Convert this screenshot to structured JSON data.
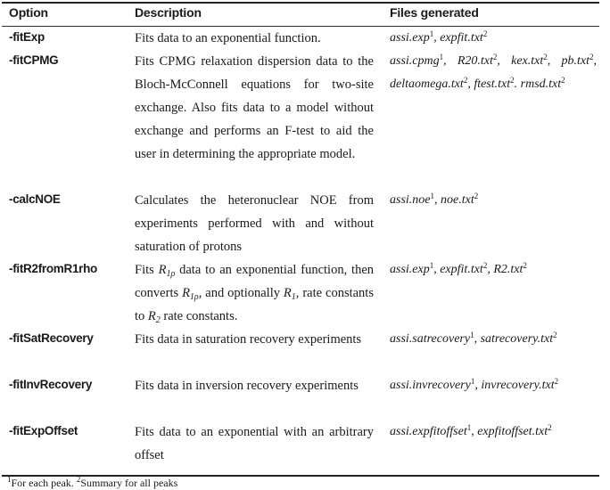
{
  "headers": {
    "option": "Option",
    "description": "Description",
    "files": "Files generated"
  },
  "rows": [
    {
      "option": "-fitExp",
      "description": "Fits data to an exponential function.",
      "files": [
        {
          "name": "assi.exp",
          "note": "1",
          "sep": ", "
        },
        {
          "name": "expfit.txt",
          "note": "2",
          "sep": ""
        }
      ]
    },
    {
      "option": "-fitCPMG",
      "description": "Fits CPMG relaxation dispersion data to the Bloch-McConnell equations for two-site exchange. Also fits data to a model without exchange and performs an F-test to aid the user in determining the appropriate model.",
      "files": [
        {
          "name": "assi.cpmg",
          "note": "1",
          "sep": ", "
        },
        {
          "name": "R20.txt",
          "note": "2",
          "sep": ", "
        },
        {
          "name": "kex.txt",
          "note": "2",
          "sep": ", "
        },
        {
          "name": "pb.txt",
          "note": "2",
          "sep": ", "
        },
        {
          "name": "deltaomega.txt",
          "note": "2",
          "sep": ", "
        },
        {
          "name": "ftest.txt",
          "note": "2",
          "sep": ". "
        },
        {
          "name": "rmsd.txt",
          "note": "2",
          "sep": ""
        }
      ]
    },
    {
      "option": "-calcNOE",
      "description": "Calculates the heteronuclear NOE from experiments performed with and without saturation of protons",
      "files": [
        {
          "name": "assi.noe",
          "note": "1",
          "sep": ", "
        },
        {
          "name": "noe.txt",
          "note": "2",
          "sep": ""
        }
      ]
    },
    {
      "option": "-fitR2fromR1rho",
      "description_parts": {
        "p1": "Fits ",
        "p2": " data to an exponential function, then converts ",
        "p3": ", and optionally ",
        "p4": ", rate constants to ",
        "p5": " rate constants.",
        "r1rho_base": "R",
        "r1rho_sub": "1ρ",
        "r1_base": "R",
        "r1_sub": "1",
        "r2_base": "R",
        "r2_sub": "2"
      },
      "files": [
        {
          "name": "assi.exp",
          "note": "1",
          "sep": ", "
        },
        {
          "name": "expfit.txt",
          "note": "2",
          "sep": ", "
        },
        {
          "name": "R2.txt",
          "note": "2",
          "sep": ""
        }
      ]
    },
    {
      "option": "-fitSatRecovery",
      "description": "Fits data in saturation recovery experiments",
      "files": [
        {
          "name": "assi.satrecovery",
          "note": "1",
          "sep": ", "
        },
        {
          "name": "satrecovery.txt",
          "note": "2",
          "sep": ""
        }
      ]
    },
    {
      "option": "-fitInvRecovery",
      "description": "Fits data in inversion recovery experiments",
      "files": [
        {
          "name": "assi.invrecovery",
          "note": "1",
          "sep": ", "
        },
        {
          "name": "invrecovery.txt",
          "note": "2",
          "sep": ""
        }
      ]
    },
    {
      "option": "-fitExpOffset",
      "description": "Fits data to an exponential with an arbitrary offset",
      "files": [
        {
          "name": "assi.expfitoffset",
          "note": "1",
          "sep": ", "
        },
        {
          "name": "expfitoffset.txt",
          "note": "2",
          "sep": ""
        }
      ]
    }
  ],
  "footnote": {
    "n1": "1",
    "t1": "For each peak. ",
    "n2": "2",
    "t2": "Summary for all peaks"
  }
}
